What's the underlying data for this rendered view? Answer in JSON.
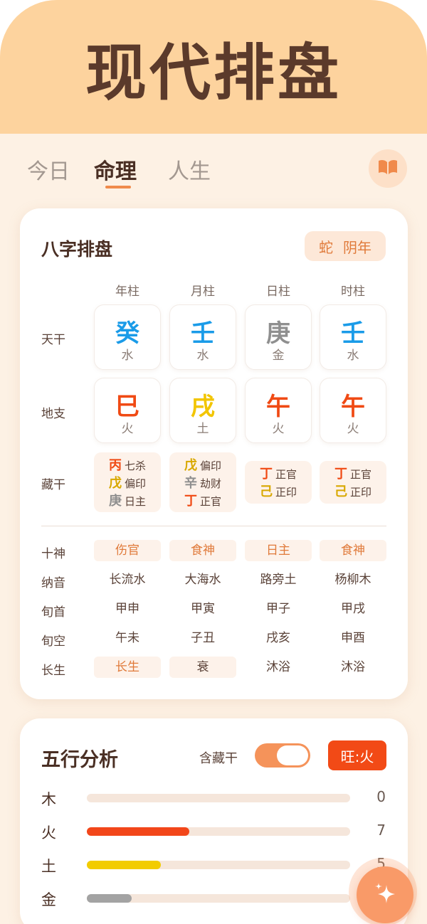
{
  "hero": {
    "title": "现代排盘"
  },
  "tabs": [
    {
      "label": "今日",
      "active": false
    },
    {
      "label": "命理",
      "active": true
    },
    {
      "label": "人生",
      "active": false
    }
  ],
  "bazi": {
    "title": "八字排盘",
    "zodiac": "蛇",
    "year_type": "阴年",
    "columns": [
      "年柱",
      "月柱",
      "日柱",
      "时柱"
    ],
    "row_labels": {
      "heavenly": "天干",
      "earthly": "地支",
      "hidden": "藏干",
      "ten_god": "十神",
      "nayin": "纳音",
      "xunshou": "旬首",
      "xunkong": "旬空",
      "changsheng": "长生"
    },
    "heavenly": [
      {
        "char": "癸",
        "element": "水",
        "color": "#1a9be8"
      },
      {
        "char": "壬",
        "element": "水",
        "color": "#1a9be8"
      },
      {
        "char": "庚",
        "element": "金",
        "color": "#8f8f8f"
      },
      {
        "char": "壬",
        "element": "水",
        "color": "#1a9be8"
      }
    ],
    "earthly": [
      {
        "char": "巳",
        "element": "火",
        "color": "#f04a14"
      },
      {
        "char": "戌",
        "element": "土",
        "color": "#f2c500"
      },
      {
        "char": "午",
        "element": "火",
        "color": "#f04a14"
      },
      {
        "char": "午",
        "element": "火",
        "color": "#f04a14"
      }
    ],
    "hidden": [
      [
        {
          "stem": "丙",
          "god": "七杀",
          "color": "#f04a14"
        },
        {
          "stem": "戊",
          "god": "偏印",
          "color": "#d8a800"
        },
        {
          "stem": "庚",
          "god": "日主",
          "color": "#8f8f8f"
        }
      ],
      [
        {
          "stem": "戊",
          "god": "偏印",
          "color": "#d8a800"
        },
        {
          "stem": "辛",
          "god": "劫财",
          "color": "#8f8f8f"
        },
        {
          "stem": "丁",
          "god": "正官",
          "color": "#f04a14"
        }
      ],
      [
        {
          "stem": "丁",
          "god": "正官",
          "color": "#f04a14"
        },
        {
          "stem": "己",
          "god": "正印",
          "color": "#d8a800"
        }
      ],
      [
        {
          "stem": "丁",
          "god": "正官",
          "color": "#f04a14"
        },
        {
          "stem": "己",
          "god": "正印",
          "color": "#d8a800"
        }
      ]
    ],
    "ten_god": [
      "伤官",
      "食神",
      "日主",
      "食神"
    ],
    "nayin": [
      "长流水",
      "大海水",
      "路旁土",
      "杨柳木"
    ],
    "xunshou": [
      "甲申",
      "甲寅",
      "甲子",
      "甲戌"
    ],
    "xunkong": [
      "午未",
      "子丑",
      "戌亥",
      "申酉"
    ],
    "changsheng": [
      "长生",
      "衰",
      "沐浴",
      "沐浴"
    ]
  },
  "wuxing": {
    "title": "五行分析",
    "toggle_label": "含藏干",
    "toggle_on": true,
    "dominant": "旺:火",
    "bars": [
      {
        "label": "木",
        "value": "0",
        "fraction": 0.0,
        "color": "#f5e6db"
      },
      {
        "label": "火",
        "value": "7",
        "fraction": 0.39,
        "color": "#f2461a"
      },
      {
        "label": "土",
        "value": "5",
        "fraction": 0.28,
        "color": "#f2cc00"
      },
      {
        "label": "金",
        "value": "",
        "fraction": 0.17,
        "color": "#a3a3a3"
      }
    ]
  },
  "icons": {
    "book": "book-icon",
    "sparkle": "sparkle-icon"
  }
}
